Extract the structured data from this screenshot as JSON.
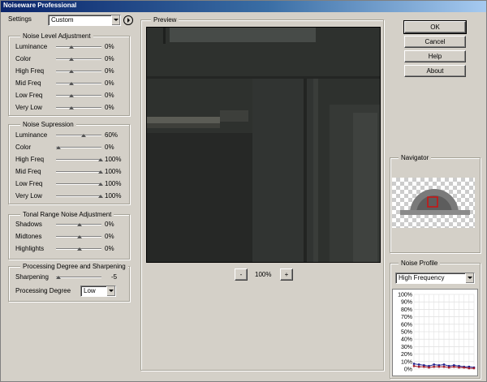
{
  "window": {
    "title": "Noiseware Professional"
  },
  "settings": {
    "label": "Settings",
    "preset": "Custom"
  },
  "noise_level": {
    "title": "Noise Level Adjustment",
    "rows": [
      {
        "label": "Luminance",
        "value": "0%",
        "pos": 0.3
      },
      {
        "label": "Color",
        "value": "0%",
        "pos": 0.3
      },
      {
        "label": "High Freq",
        "value": "0%",
        "pos": 0.3
      },
      {
        "label": "Mid Freq",
        "value": "0%",
        "pos": 0.3
      },
      {
        "label": "Low Freq",
        "value": "0%",
        "pos": 0.3
      },
      {
        "label": "Very Low",
        "value": "0%",
        "pos": 0.3
      }
    ]
  },
  "noise_suppression": {
    "title": "Noise Supression",
    "rows": [
      {
        "label": "Luminance",
        "value": "60%",
        "pos": 0.6
      },
      {
        "label": "Color",
        "value": "0%",
        "pos": 0.0
      },
      {
        "label": "High Freq",
        "value": "100%",
        "pos": 1.0
      },
      {
        "label": "Mid Freq",
        "value": "100%",
        "pos": 1.0
      },
      {
        "label": "Low Freq",
        "value": "100%",
        "pos": 1.0
      },
      {
        "label": "Very Low",
        "value": "100%",
        "pos": 1.0
      }
    ]
  },
  "tonal": {
    "title": "Tonal Range Noise Adjustment",
    "rows": [
      {
        "label": "Shadows",
        "value": "0%",
        "pos": 0.5
      },
      {
        "label": "Midtones",
        "value": "0%",
        "pos": 0.5
      },
      {
        "label": "Highlights",
        "value": "0%",
        "pos": 0.5
      }
    ]
  },
  "processing": {
    "title": "Processing Degree and Sharpening",
    "sharpening_label": "Sharpening",
    "sharpening_value": "-5",
    "sharpening_pos": 0.0,
    "degree_label": "Processing Degree",
    "degree_value": "Low"
  },
  "preview": {
    "title": "Preview",
    "zoom": "100%",
    "minus": "-",
    "plus": "+"
  },
  "buttons": {
    "ok": "OK",
    "cancel": "Cancel",
    "help": "Help",
    "about": "About"
  },
  "navigator": {
    "title": "Navigator"
  },
  "noise_profile": {
    "title": "Noise Profile",
    "select": "High Frequency",
    "y_ticks": [
      "100%",
      "90%",
      "80%",
      "70%",
      "60%",
      "50%",
      "40%",
      "30%",
      "20%",
      "10%",
      "0%"
    ]
  },
  "chart_data": {
    "type": "line",
    "ylim": [
      0,
      100
    ],
    "y_ticks": [
      "100%",
      "90%",
      "80%",
      "70%",
      "60%",
      "50%",
      "40%",
      "30%",
      "20%",
      "10%",
      "0%"
    ],
    "series": [
      {
        "values": [
          7,
          6,
          5,
          4,
          6,
          5,
          6,
          4,
          5,
          4,
          3,
          3,
          2
        ]
      },
      {
        "values": [
          4,
          3,
          3,
          2,
          3,
          3,
          3,
          2,
          3,
          2,
          2,
          1,
          1
        ]
      }
    ],
    "colors": [
      "#1e1e8a",
      "#a01a2a"
    ]
  }
}
